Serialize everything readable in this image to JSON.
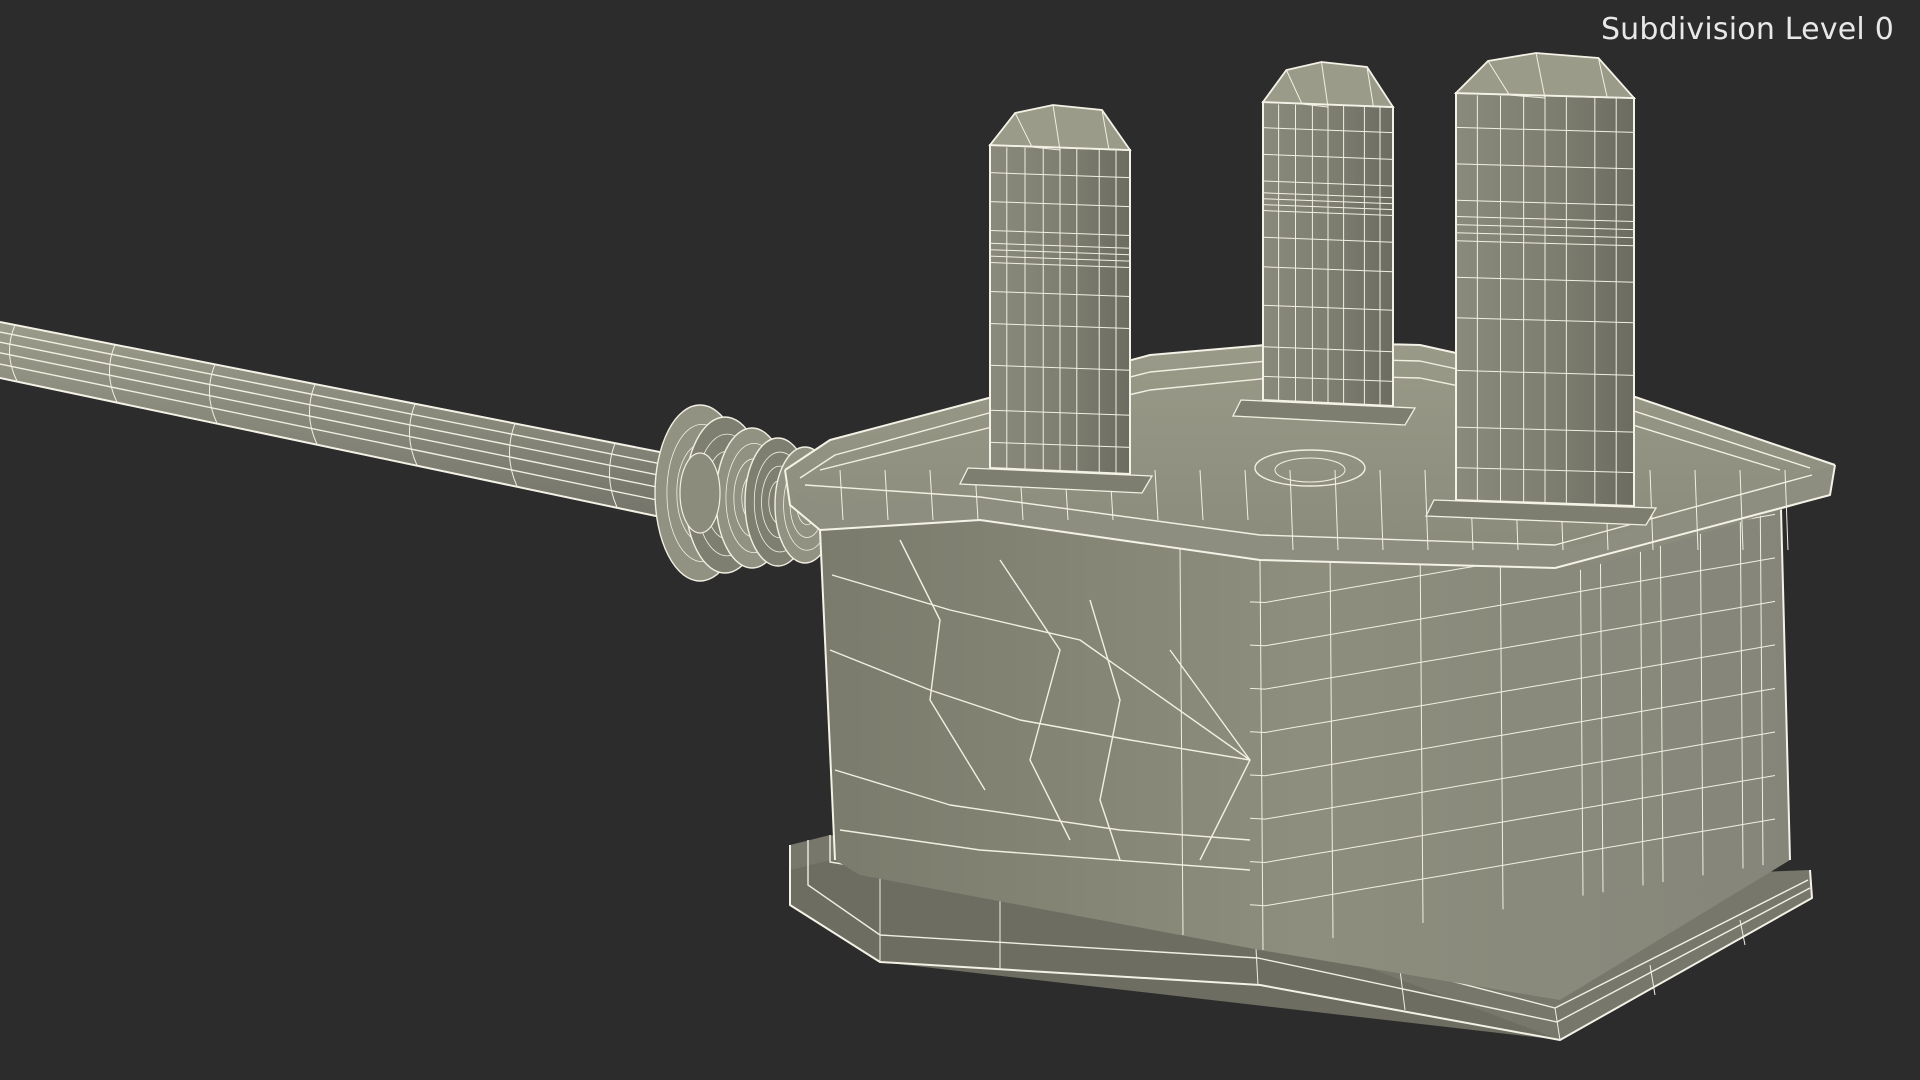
{
  "viewport": {
    "subdivision_label": "Subdivision Level 0"
  },
  "colors": {
    "background": "#2c2c2c",
    "surface": "#8a8a7a",
    "surface_dark": "#6f6f62",
    "surface_light": "#9a9a8a",
    "wireframe": "#f1efe2"
  },
  "icons": {
    "model": "plug-wireframe-model"
  }
}
